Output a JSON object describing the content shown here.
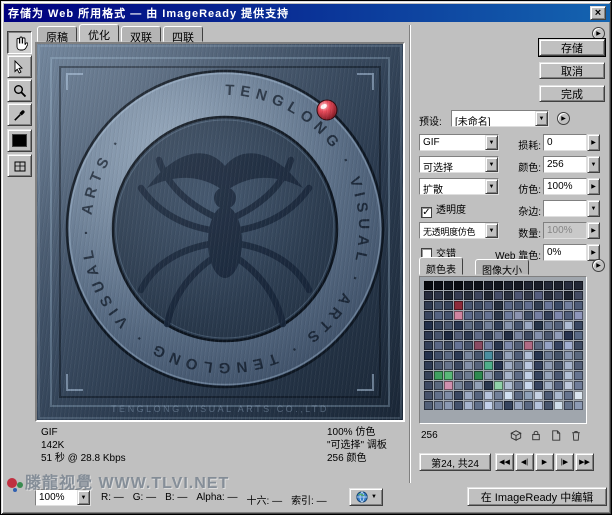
{
  "window": {
    "title": "存储为 Web 所用格式 — 由 ImageReady 提供支持",
    "close_glyph": "×"
  },
  "view_tabs": {
    "items": [
      {
        "label": "原稿"
      },
      {
        "label": "优化"
      },
      {
        "label": "双联"
      },
      {
        "label": "四联"
      }
    ],
    "active": "优化"
  },
  "tools": {
    "hand": "hand-tool",
    "slice_select": "slice-select-tool",
    "zoom": "zoom-tool",
    "eyedropper": "eyedropper-tool",
    "swatch_color": "#000000",
    "toggle_slices": "toggle-slices-visibility"
  },
  "preview": {
    "ring_text": "TENGLONG · VISUAL · ARTS · TENGLONG · VISUAL · ARTS ·",
    "caption": "TENGLONG VISUAL ARTS CO.,LTD"
  },
  "actions": {
    "save": "存储",
    "cancel": "取消",
    "done": "完成"
  },
  "settings": {
    "preset_label": "预设:",
    "preset": "[未命名]",
    "format": "GIF",
    "lossy_label": "损耗:",
    "lossy": "0",
    "palette": "可选择",
    "colors_label": "颜色:",
    "colors": "256",
    "dither_method": "扩散",
    "dither_label": "仿色:",
    "dither": "100%",
    "transparency_label": "透明度",
    "transparency_checked": true,
    "matte_label": "杂边:",
    "matte": "",
    "trans_dither": "无透明度仿色",
    "amount_label": "数量:",
    "amount": "100%",
    "interlaced_label": "交错",
    "interlaced_checked": false,
    "websnap_label": "Web 靠色:",
    "websnap": "0%"
  },
  "color_table": {
    "tabs": [
      {
        "label": "颜色表"
      },
      {
        "label": "图像大小"
      }
    ],
    "count": "256",
    "palette": [
      [
        "#070a10",
        "#0b0e15",
        "#0f131b",
        "#090c12",
        "#131720",
        "#0d1119",
        "#171b26",
        "#11151e",
        "#1b202c",
        "#151923",
        "#1f2432",
        "#191d28",
        "#232837",
        "#1d212d",
        "#272c3d",
        "#212634"
      ],
      [
        "#252b3c",
        "#2d3447",
        "#1f2532",
        "#353c52",
        "#29303f",
        "#3d455d",
        "#232936",
        "#454d68",
        "#2b3242",
        "#4d5573",
        "#333a4c",
        "#555d7e",
        "#292f3e",
        "#3b4358",
        "#1d2330",
        "#434b62"
      ],
      [
        "#2e3a50",
        "#425068",
        "#36445c",
        "#8e2a3a",
        "#4a5872",
        "#3e4c64",
        "#525f7c",
        "#26303f",
        "#5a6886",
        "#46546e",
        "#626f90",
        "#323e52",
        "#6a779a",
        "#3a4a66",
        "#72809f",
        "#4e5c78"
      ],
      [
        "#38455e",
        "#556381",
        "#45536e",
        "#d184a0",
        "#5d6b8b",
        "#4d5b76",
        "#657393",
        "#2e3a4e",
        "#6d7b9d",
        "#8b93b0",
        "#414f68",
        "#757fa2",
        "#35415a",
        "#7d87ac",
        "#515f7c",
        "#8e96ba"
      ],
      [
        "#22304a",
        "#36445c",
        "#4a5870",
        "#2a3852",
        "#5e6c84",
        "#3e4c66",
        "#72809a",
        "#32405a",
        "#8694ae",
        "#46546e",
        "#9aa8c2",
        "#263448",
        "#6e7c96",
        "#52607a",
        "#aebcd4",
        "#3a4862"
      ],
      [
        "#2c3850",
        "#48546c",
        "#1e2a42",
        "#545f7a",
        "#303c54",
        "#606c88",
        "#38445c",
        "#6c7894",
        "#242f46",
        "#7884a0",
        "#404c64",
        "#8490ac",
        "#4c5870",
        "#909cb8",
        "#283450",
        "#5a6a86"
      ],
      [
        "#334058",
        "#596684",
        "#3d4a62",
        "#657294",
        "#47546c",
        "#8a4a62",
        "#717ea0",
        "#29364e",
        "#7d8aac",
        "#515e76",
        "#b06a84",
        "#5b6880",
        "#95a2c4",
        "#354260",
        "#a1aed0",
        "#3f4c64"
      ],
      [
        "#24324c",
        "#404e68",
        "#5c6a84",
        "#2c3a54",
        "#78869e",
        "#48566e",
        "#4a8ea0",
        "#36445e",
        "#94a2ba",
        "#505e78",
        "#b0bed6",
        "#283650",
        "#6c7a94",
        "#445268",
        "#8896b0",
        "#5a687e"
      ],
      [
        "#2f3c54",
        "#4b5870",
        "#67748c",
        "#3b4860",
        "#8390a8",
        "#57647c",
        "#4fae8a",
        "#273450",
        "#9facc4",
        "#637088",
        "#bbc8e0",
        "#33405c",
        "#8f9cb4",
        "#47546c",
        "#a7b4cc",
        "#535f78"
      ],
      [
        "#364258",
        "#3fa060",
        "#59b878",
        "#526078",
        "#6e7c92",
        "#2e8a50",
        "#8a98ae",
        "#42506a",
        "#a6b4ca",
        "#5e6c86",
        "#c2d0e6",
        "#36445e",
        "#96a4ba",
        "#4a5872",
        "#b2c0d6",
        "#667490"
      ],
      [
        "#3e4a62",
        "#5a687e",
        "#d08fae",
        "#76849a",
        "#47546e",
        "#92a0b6",
        "#2a3850",
        "#8fd0a8",
        "#aebcd2",
        "#63708a",
        "#cad8ee",
        "#374460",
        "#a2b0c6",
        "#53607c",
        "#bec8dc",
        "#6f7c98"
      ],
      [
        "#46526a",
        "#62708a",
        "#7e8ca6",
        "#3a4862",
        "#9aa8c2",
        "#56647e",
        "#b6c4de",
        "#72809a",
        "#d2e0f2",
        "#5c6a84",
        "#8ea0b8",
        "#c6d2e4",
        "#4e5c76",
        "#aab8ce",
        "#66748e",
        "#dce6f0"
      ],
      [
        "#526078",
        "#6e7c96",
        "#8a98b2",
        "#44526c",
        "#a6b4ce",
        "#60708a",
        "#c2d0ea",
        "#7c8aa4",
        "#36445e",
        "#98a6c0",
        "#5a6882",
        "#b4c2dc",
        "#48566e",
        "#d0deea",
        "#66748c",
        "#8c9ab4"
      ]
    ]
  },
  "pager": {
    "label": "第24, 共24",
    "buttons": [
      "◀◀",
      "◀|",
      "▶",
      "|▶",
      "▶▶"
    ]
  },
  "statusbar": {
    "zoom": "100%",
    "readout": [
      {
        "label": "R:",
        "value": "—"
      },
      {
        "label": "G:",
        "value": "—"
      },
      {
        "label": "B:",
        "value": "—"
      },
      {
        "label": "Alpha:",
        "value": "—"
      },
      {
        "label": "十六:",
        "value": "—"
      },
      {
        "label": "索引:",
        "value": "—"
      }
    ],
    "edit_button": "在 ImageReady 中编辑"
  },
  "optimize_info": {
    "left": [
      "GIF",
      "142K",
      "51 秒 @ 28.8 Kbps"
    ],
    "right": [
      "100% 仿色",
      "\"可选择\" 调板",
      "256 颜色"
    ]
  },
  "watermark": "滕龍视覺 WWW.TLVI.NET",
  "colors": {
    "titlebar_left": "#00007e",
    "titlebar_right": "#1464b0",
    "chrome": "#c0c0c0",
    "plate": "#31425a",
    "gem": "#d23040"
  }
}
